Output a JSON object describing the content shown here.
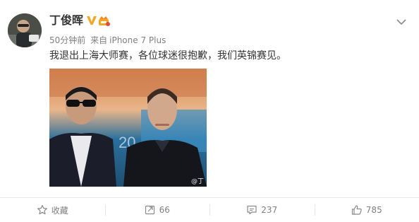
{
  "user": {
    "name": "丁俊晖",
    "verified_icon": "verified-v-icon",
    "member_icon": "vip-member-icon"
  },
  "post": {
    "time": "50分钟前",
    "source_prefix": "来自",
    "source": "iPhone 7 Plus",
    "text": "我退出上海大师赛，各位球迷很抱歉，我们英锦赛见。",
    "image_watermark": "@丁"
  },
  "actions": {
    "favorite": {
      "label": "收藏",
      "icon": "star-icon"
    },
    "repost": {
      "label": "66",
      "icon": "repost-icon"
    },
    "comment": {
      "label": "237",
      "icon": "comment-icon"
    },
    "like": {
      "label": "785",
      "icon": "thumbs-up-icon"
    }
  },
  "menu_icon": "chevron-down-icon",
  "colors": {
    "text": "#333333",
    "meta": "#808080",
    "verified": "#f5a623"
  }
}
